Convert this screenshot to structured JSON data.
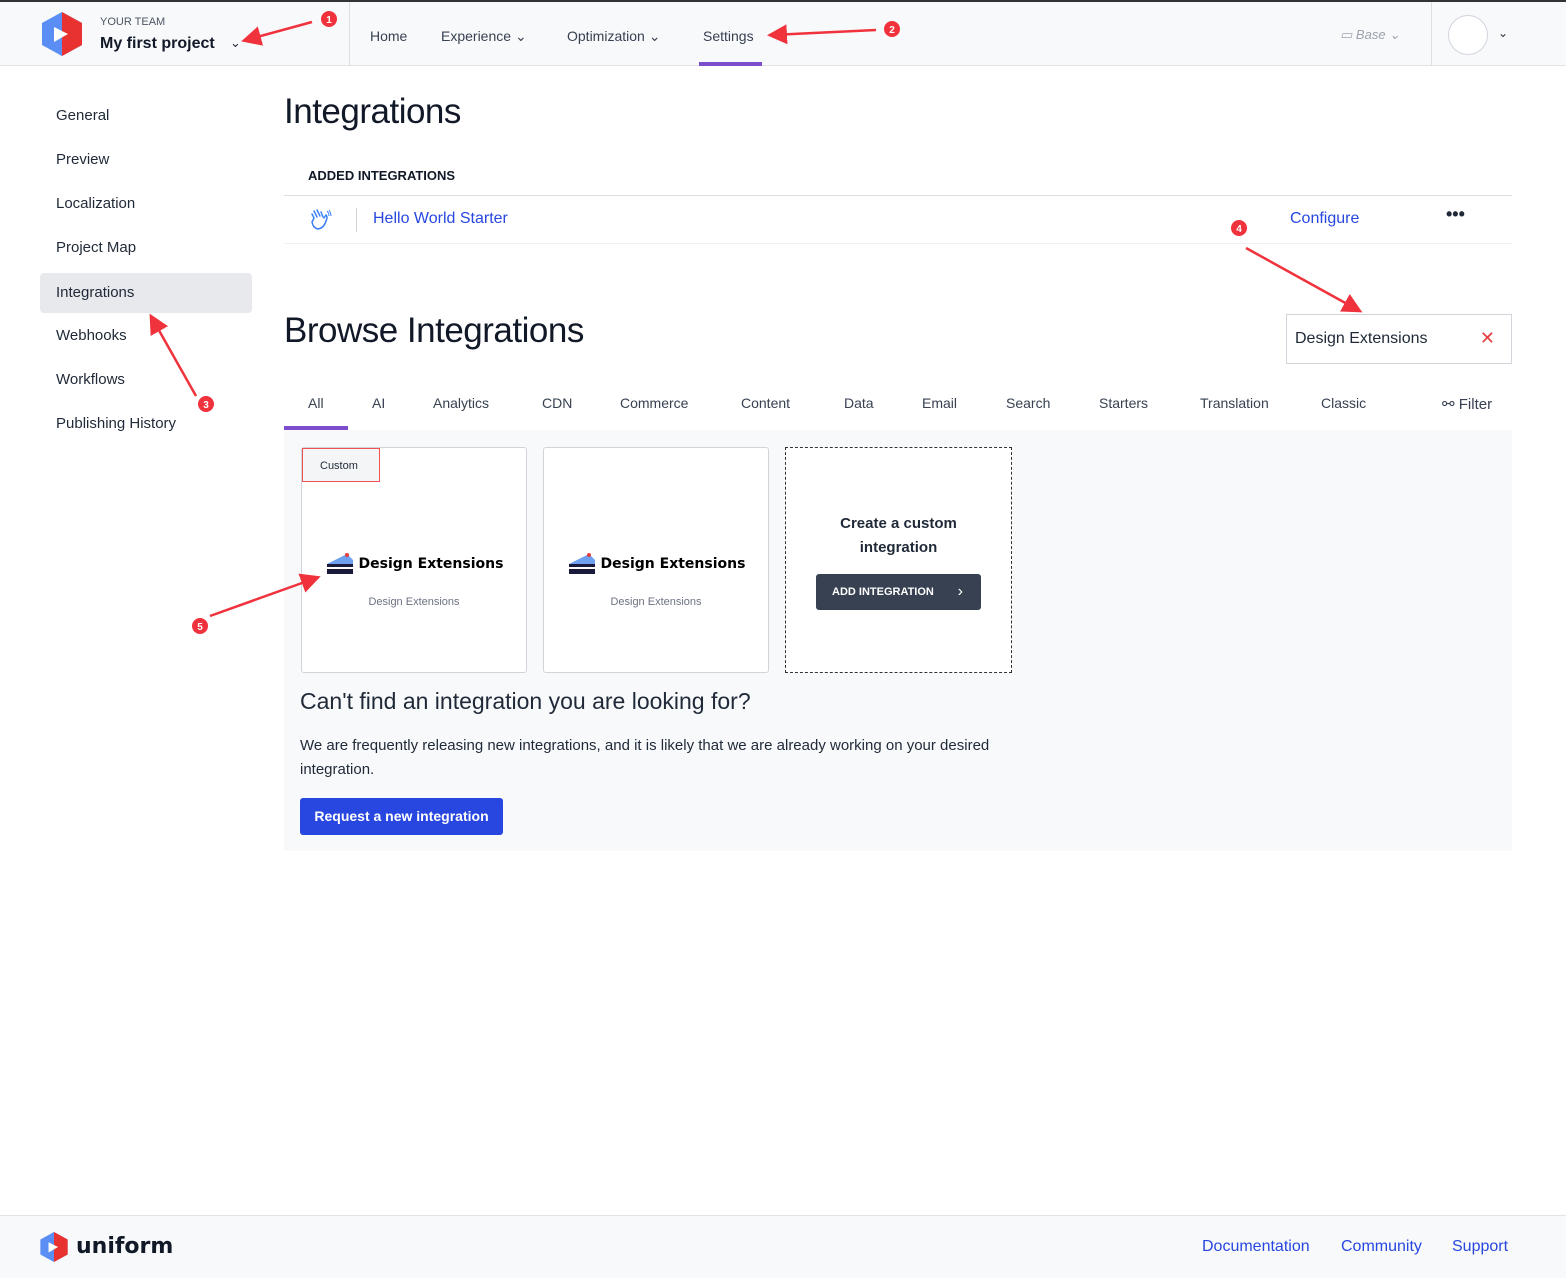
{
  "header": {
    "team_label": "YOUR TEAM",
    "project": "My first project",
    "nav": [
      {
        "label": "Home"
      },
      {
        "label": "Experience"
      },
      {
        "label": "Optimization"
      },
      {
        "label": "Settings",
        "active": true
      }
    ],
    "branch": "Base"
  },
  "sidebar": {
    "items": [
      {
        "label": "General"
      },
      {
        "label": "Preview"
      },
      {
        "label": "Localization"
      },
      {
        "label": "Project Map"
      },
      {
        "label": "Integrations",
        "active": true
      },
      {
        "label": "Webhooks"
      },
      {
        "label": "Workflows"
      },
      {
        "label": "Publishing History"
      }
    ]
  },
  "main": {
    "title": "Integrations",
    "added_heading": "ADDED INTEGRATIONS",
    "added": [
      {
        "name": "Hello World Starter",
        "icon": "waving-hand-icon",
        "action": "Configure",
        "more": "•••"
      }
    ],
    "browse_title": "Browse Integrations",
    "search": {
      "value": "Design Extensions"
    },
    "tabs": [
      {
        "label": "All",
        "active": true
      },
      {
        "label": "AI"
      },
      {
        "label": "Analytics"
      },
      {
        "label": "CDN"
      },
      {
        "label": "Commerce"
      },
      {
        "label": "Content"
      },
      {
        "label": "Data"
      },
      {
        "label": "Email"
      },
      {
        "label": "Search"
      },
      {
        "label": "Starters"
      },
      {
        "label": "Translation"
      },
      {
        "label": "Classic"
      }
    ],
    "filter_label": "Filter",
    "cards": [
      {
        "badge": "Custom",
        "title": "Design Extensions",
        "subtitle": "Design Extensions"
      },
      {
        "title": "Design Extensions",
        "subtitle": "Design Extensions"
      }
    ],
    "custom_card": {
      "title_line1": "Create a custom",
      "title_line2": "integration",
      "button": "ADD INTEGRATION"
    },
    "cant_find": "Can't find an integration you are looking for?",
    "paragraph": "We are frequently releasing new integrations, and it is likely that we are already working on your desired integration.",
    "request_button": "Request a new integration"
  },
  "footer": {
    "brand": "uniform",
    "links": [
      "Documentation",
      "Community",
      "Support"
    ]
  },
  "annotations": [
    "1",
    "2",
    "3",
    "4",
    "5"
  ],
  "colors": {
    "accent": "#7c4dcc",
    "link": "#2747e0",
    "annotation": "#f0323c"
  }
}
